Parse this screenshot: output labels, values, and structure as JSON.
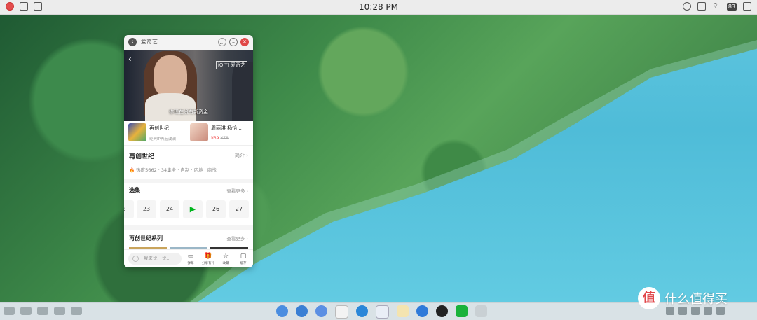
{
  "menubar": {
    "clock": "10:28 PM",
    "battery": "83"
  },
  "window": {
    "title": "爱奇艺",
    "video": {
      "logo": "iQIYI 爱奇艺",
      "subtitle": "你现在没有新资金"
    },
    "promos": [
      {
        "title": "再创世纪",
        "subtitle": "经典IP再起波澜"
      },
      {
        "title": "周丽淇 杨怡...",
        "price": "¥39",
        "original_price": "¥78"
      }
    ],
    "show": {
      "title": "再创世纪",
      "intro_label": "简介",
      "meta": "热度5662 · 34集全 · 自制 · 内地 · 商战"
    },
    "episodes_section": {
      "title": "选集",
      "more": "查看更多",
      "episodes": [
        "2",
        "23",
        "24",
        "▶",
        "26",
        "27"
      ]
    },
    "series_section": {
      "title": "再创世纪系列",
      "more": "查看更多"
    },
    "bottom": {
      "comment_placeholder": "我来说一说...",
      "actions": [
        {
          "label": "弹幕",
          "icon": "danmaku-icon"
        },
        {
          "label": "分享有礼",
          "icon": "gift-icon"
        },
        {
          "label": "收藏",
          "icon": "star-icon"
        },
        {
          "label": "缓存",
          "icon": "download-icon"
        }
      ]
    }
  },
  "watermark": {
    "badge": "值",
    "text": "什么值得买"
  },
  "colors": {
    "accent_green": "#00b51d",
    "close_red": "#e04848",
    "price_red": "#f24d4d"
  }
}
